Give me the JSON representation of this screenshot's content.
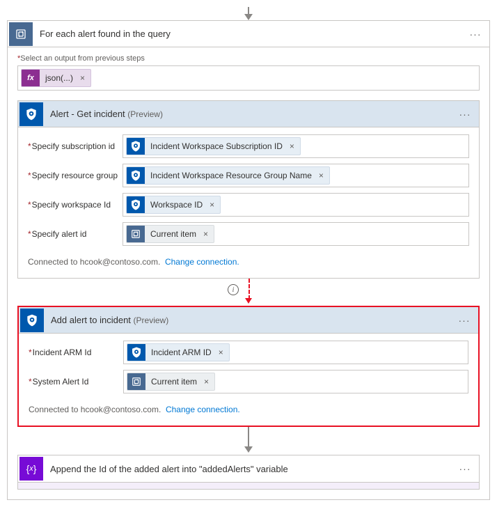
{
  "loop": {
    "title": "For each alert found in the query",
    "output_label": "Select an output from previous steps",
    "fx_token": "json(...)"
  },
  "get_incident": {
    "title": "Alert - Get incident",
    "preview": "(Preview)",
    "rows": [
      {
        "label": "Specify subscription id",
        "token": "Incident Workspace Subscription ID",
        "type": "sentinel"
      },
      {
        "label": "Specify resource group",
        "token": "Incident Workspace Resource Group Name",
        "type": "sentinel"
      },
      {
        "label": "Specify workspace Id",
        "token": "Workspace ID",
        "type": "sentinel"
      },
      {
        "label": "Specify alert id",
        "token": "Current item",
        "type": "loop"
      }
    ],
    "conn_text": "Connected to hcook@contoso.com.",
    "conn_link": "Change connection."
  },
  "add_alert": {
    "title": "Add alert to incident",
    "preview": "(Preview)",
    "rows": [
      {
        "label": "Incident ARM Id",
        "token": "Incident ARM ID",
        "type": "sentinel"
      },
      {
        "label": "System Alert Id",
        "token": "Current item",
        "type": "loop"
      }
    ],
    "conn_text": "Connected to hcook@contoso.com.",
    "conn_link": "Change connection."
  },
  "append": {
    "title": "Append the Id of the added alert into \"addedAlerts\" variable"
  },
  "info_badge": "i",
  "dots": "···",
  "close_x": "×"
}
